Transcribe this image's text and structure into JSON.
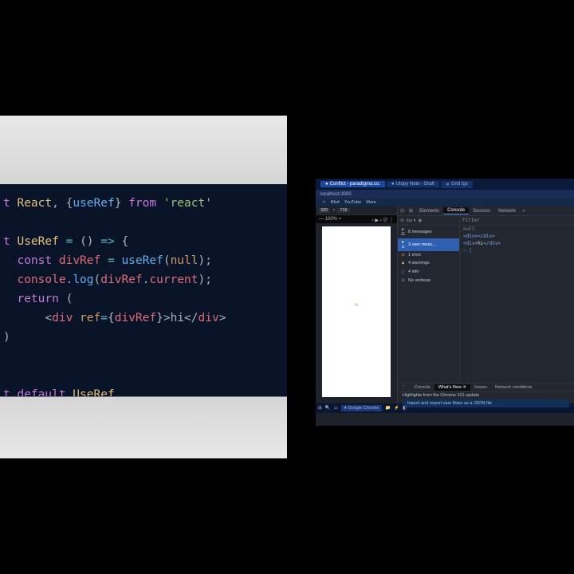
{
  "code": {
    "line1": {
      "kw1": "t",
      "cls1": "React",
      "pn1": ", {",
      "fn1": "useRef",
      "pn2": "} ",
      "kw2": "from",
      "str1": " 'react'"
    },
    "line3": {
      "kw1": "t",
      "cls1": "UseRef",
      "op1": " = ",
      "pn1": "()",
      "op2": " => ",
      "pn2": "{"
    },
    "line4": {
      "kw1": "const",
      "var1": " divRef",
      "op1": " = ",
      "fn1": "useRef",
      "pn1": "(",
      "kw2": "null",
      "pn2": ");"
    },
    "line5": {
      "var1": "console",
      "pn1": ".",
      "fn1": "log",
      "pn2": "(",
      "var2": "divRef",
      "pn3": ".",
      "var3": "current",
      "pn4": ");"
    },
    "line6": {
      "kw1": "return",
      "pn1": " ("
    },
    "line7": {
      "pn1": "<",
      "tag1": "div",
      "attr1": " ref",
      "op1": "=",
      "pn2": "{",
      "var1": "divRef",
      "pn3": "}>",
      "txt1": "hi",
      "pn4": "</",
      "tag2": "div",
      "pn5": ">"
    },
    "line8": {
      "pn1": ")"
    },
    "line10": {
      "kw1": "t",
      "kw2": "default",
      "cls1": " UseRef"
    }
  },
  "browser": {
    "tabs": [
      {
        "icon": "●",
        "label": "Conflict - paradigma.co."
      },
      {
        "icon": "●",
        "label": "Utopy Note - Draft"
      },
      {
        "icon": "✕",
        "label": "Grid.fgs"
      }
    ],
    "url": "localhost:3000",
    "bookmarks": [
      "☆",
      "Blvd",
      "YouTube",
      "More"
    ],
    "mobile": {
      "width": "320",
      "mult": "×",
      "height": "716",
      "pct_label": "%"
    },
    "video": {
      "left": "— 100% +",
      "right": "‹ ▶ › 〄 ⋮"
    },
    "preview_text": "hi",
    "dt_tabs": [
      "Elements",
      "Console",
      "Sources",
      "Network"
    ],
    "dt_tabs_prefix_icons": [
      "⊡",
      "⊞"
    ],
    "dt_tabs_suffix": "»",
    "sidebar_top": {
      "ban": "⊘",
      "top": "top ▾",
      "eye": "◉"
    },
    "messages": [
      {
        "icon": "▸ ☰",
        "text": "8 messages"
      },
      {
        "icon": "▸ ☺",
        "text": "3 user mess…"
      },
      {
        "icon": "⊘",
        "text": "1 error",
        "color": "#e06c75"
      },
      {
        "icon": "▲",
        "text": "4 warnings",
        "color": "#e5c07b"
      },
      {
        "icon": "ⓘ",
        "text": "4 info",
        "color": "#5c9ded"
      },
      {
        "icon": "⊝",
        "text": "No verbose",
        "color": "#8a93a2"
      }
    ],
    "filter_placeholder": "Filter",
    "console_out": [
      {
        "type": "null",
        "text": "null"
      },
      {
        "type": "tag",
        "open": "<div>",
        "close": "</div>"
      },
      {
        "type": "nested",
        "indent": "    ",
        "open": "<div>",
        "inner": "hi",
        "close": "</div>"
      },
      {
        "type": "prompt",
        "text": "› |"
      }
    ],
    "lower_tabs": [
      "⋮",
      "Console",
      "What's New ✕",
      "Issues",
      "Network conditions"
    ],
    "lower_title": "Highlights from the Chrome 101 update",
    "promo": "Import and export user flows as a JSON file"
  },
  "taskbar": {
    "items": [
      "⊞",
      "🔍",
      "▭",
      "● Google Chrome",
      "📁",
      "⚡",
      "◧"
    ]
  }
}
